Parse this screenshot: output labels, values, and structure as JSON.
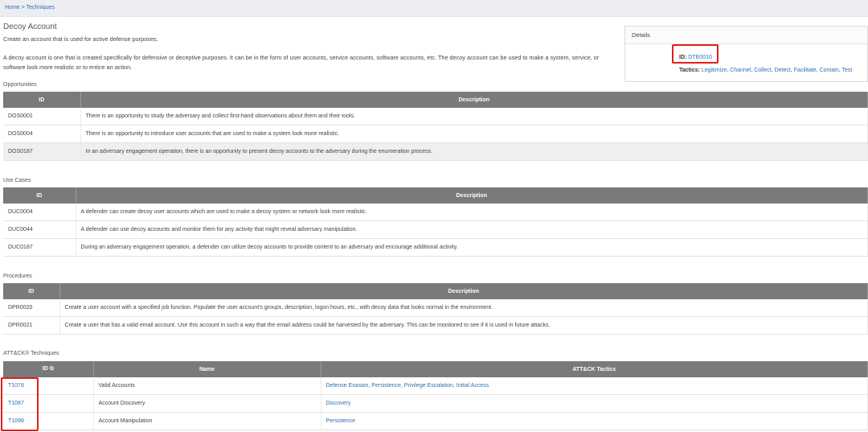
{
  "breadcrumb": {
    "home": "Home",
    "separator": ">",
    "current": "Techniques"
  },
  "page": {
    "title": "Decoy Account",
    "summary": "Create an account that is used for active defense purposes.",
    "description": "A decoy account is one that is created specifically for defensive or deceptive purposes. It can be in the form of user accounts, service accounts, software accounts, etc. The decoy account can be used to make a system, service, or software look more realistic or to entice an action."
  },
  "details": {
    "header": "Details",
    "id_label": "ID:",
    "id_value": "DTE0010",
    "tactics_label": "Tactics:",
    "tactics": [
      "Legitimize",
      "Channel",
      "Collect",
      "Detect",
      "Facilitate",
      "Contain",
      "Test"
    ]
  },
  "opportunities": {
    "label": "Opportunities",
    "headers": [
      "ID",
      "Description"
    ],
    "rows": [
      [
        "DOS0001",
        "There is an opportunity to study the adversary and collect first-hand observations about them and their tools."
      ],
      [
        "DOS0004",
        "There is an opportunity to introduce user accounts that are used to make a system look more realistic."
      ],
      [
        "DOS0187",
        "In an adversary engagement operation, there is an opportunity to present decoy accounts to the adversary during the enumeration process."
      ]
    ]
  },
  "use_cases": {
    "label": "Use Cases",
    "headers": [
      "ID",
      "Description"
    ],
    "rows": [
      [
        "DUC0004",
        "A defender can create decoy user accounts which are used to make a decoy system or network look more realistic."
      ],
      [
        "DUC0044",
        "A defender can use decoy accounts and monitor them for any activity that might reveal adversary manipulation."
      ],
      [
        "DUC0187",
        "During an adversary engagement operation, a defender can utilize decoy accounts to provide content to an adversary and encourage additional activity."
      ]
    ]
  },
  "procedures": {
    "label": "Procedures",
    "headers": [
      "ID",
      "Description"
    ],
    "rows": [
      [
        "DPR0020",
        "Create a user account with a specified job function. Populate the user account's groups, description, logon hours, etc., with decoy data that looks normal in the environment."
      ],
      [
        "DPR0021",
        "Create a user that has a valid email account. Use this account in such a way that the email address could be harvested by the adversary. This can be monitored to see if it is used in future attacks."
      ]
    ]
  },
  "attack": {
    "label": "ATT&CK® Techniques",
    "headers": [
      "ID",
      "Name",
      "ATT&CK Tactics"
    ],
    "rows": [
      {
        "id": "T1078",
        "name": "Valid Accounts",
        "tactics": "Defense Evasion, Persistence, Privilege Escalation, Initial Access"
      },
      {
        "id": "T1087",
        "name": "Account Discovery",
        "tactics": "Discovery"
      },
      {
        "id": "T1098",
        "name": "Account Manipulation",
        "tactics": "Persistence"
      }
    ]
  }
}
